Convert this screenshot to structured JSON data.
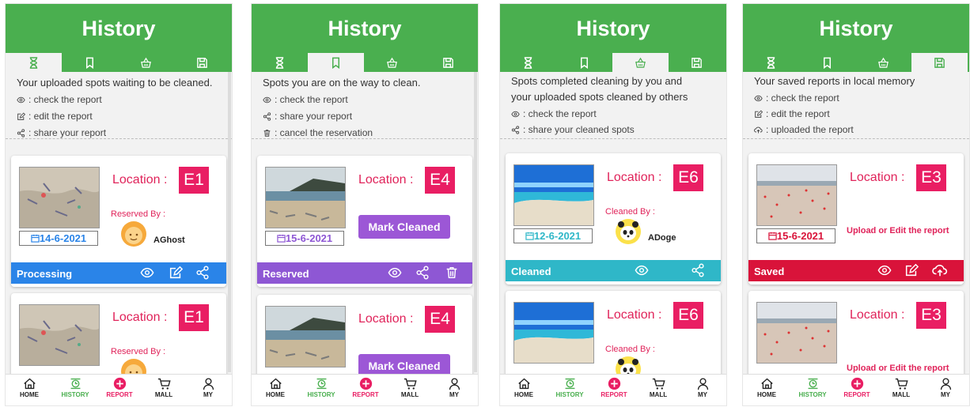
{
  "colors": {
    "header": "#4aaf4f",
    "location_box": "#e91e63",
    "processing": "#2a84e8",
    "reserved": "#8e57d4",
    "cleaned": "#2fb7c8",
    "saved": "#d9133a",
    "mark_cleaned_button": "#9c57d6"
  },
  "nav": {
    "home": "HOME",
    "history": "HISTORY",
    "report": "REPORT",
    "mall": "MALL",
    "my": "MY"
  },
  "panels": [
    {
      "title": "History",
      "active_tab": "processing",
      "info": {
        "main": "Your uploaded spots waiting to be cleaned.",
        "l1": ": check the report",
        "l2": ": edit the report",
        "l3": ": share your report"
      },
      "card1": {
        "location_label": "Location :",
        "location": "E1",
        "date": "14-6-2021",
        "by_label": "Reserved By :",
        "user": "AGhost",
        "status": "Processing"
      },
      "card2": {
        "location_label": "Location :",
        "location": "E1",
        "by_label": "Reserved By :"
      }
    },
    {
      "title": "History",
      "active_tab": "reserved",
      "info": {
        "main": "Spots you are on the way to clean.",
        "l1": ": check the report",
        "l2": ": share your report",
        "l3": ": cancel the reservation"
      },
      "card1": {
        "location_label": "Location :",
        "location": "E4",
        "date": "15-6-2021",
        "button": "Mark Cleaned",
        "status": "Reserved"
      },
      "card2": {
        "location_label": "Location :",
        "location": "E4",
        "button": "Mark Cleaned"
      }
    },
    {
      "title": "History",
      "active_tab": "cleaned",
      "info": {
        "main": "Spots completed cleaning by you and",
        "main2": "your uploaded spots cleaned by others",
        "l1": ": check the report",
        "l2": ": share your cleaned spots"
      },
      "card1": {
        "location_label": "Location :",
        "location": "E6",
        "date": "12-6-2021",
        "by_label": "Cleaned By :",
        "user": "ADoge",
        "status": "Cleaned"
      },
      "card2": {
        "location_label": "Location :",
        "location": "E6",
        "by_label": "Cleaned By :"
      }
    },
    {
      "title": "History",
      "active_tab": "saved",
      "info": {
        "main": "Your saved reports in local memory",
        "l1": ": check the report",
        "l2": ": edit the report",
        "l3": ": uploaded the report"
      },
      "card1": {
        "location_label": "Location :",
        "location": "E3",
        "date": "15-6-2021",
        "link": "Upload or Edit the report",
        "status": "Saved"
      },
      "card2": {
        "location_label": "Location :",
        "location": "E3",
        "link": "Upload or Edit the report"
      }
    }
  ]
}
